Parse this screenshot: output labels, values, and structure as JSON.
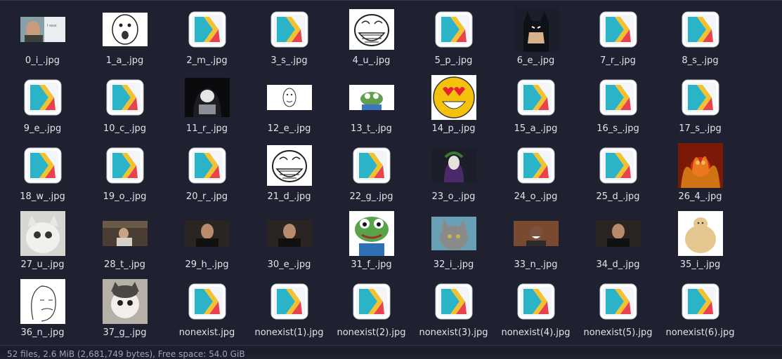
{
  "files": [
    {
      "name": "0_i_.jpg",
      "thumb": "photo-man-phone-thumb",
      "caption": "I ssss"
    },
    {
      "name": "1_a_.jpg",
      "thumb": "meme-face-lol-thumb"
    },
    {
      "name": "2_m_.jpg",
      "thumb": "broken-image-app-icon"
    },
    {
      "name": "3_s_.jpg",
      "thumb": "broken-image-app-icon"
    },
    {
      "name": "4_u_.jpg",
      "thumb": "troll-face-thumb"
    },
    {
      "name": "5_p_.jpg",
      "thumb": "broken-image-app-icon"
    },
    {
      "name": "6_e_.jpg",
      "thumb": "batman-thumb"
    },
    {
      "name": "7_r_.jpg",
      "thumb": "broken-image-app-icon"
    },
    {
      "name": "8_s_.jpg",
      "thumb": "broken-image-app-icon"
    },
    {
      "name": "9_e_.jpg",
      "thumb": "broken-image-app-icon"
    },
    {
      "name": "10_c_.jpg",
      "thumb": "broken-image-app-icon"
    },
    {
      "name": "11_r_.jpg",
      "thumb": "hacker-troll-thumb"
    },
    {
      "name": "12_e_.jpg",
      "thumb": "meme-face-small-thumb"
    },
    {
      "name": "13_t_.jpg",
      "thumb": "pepe-small-thumb"
    },
    {
      "name": "14_p_.jpg",
      "thumb": "heart-eyes-face-thumb"
    },
    {
      "name": "15_a_.jpg",
      "thumb": "broken-image-app-icon"
    },
    {
      "name": "16_s_.jpg",
      "thumb": "broken-image-app-icon"
    },
    {
      "name": "17_s_.jpg",
      "thumb": "broken-image-app-icon"
    },
    {
      "name": "18_w_.jpg",
      "thumb": "broken-image-app-icon"
    },
    {
      "name": "19_o_.jpg",
      "thumb": "broken-image-app-icon"
    },
    {
      "name": "20_r_.jpg",
      "thumb": "broken-image-app-icon"
    },
    {
      "name": "21_d_.jpg",
      "thumb": "troll-face-thumb"
    },
    {
      "name": "22_g_.jpg",
      "thumb": "broken-image-app-icon"
    },
    {
      "name": "23_o_.jpg",
      "thumb": "joker-thumb"
    },
    {
      "name": "24_o_.jpg",
      "thumb": "broken-image-app-icon"
    },
    {
      "name": "25_d_.jpg",
      "thumb": "broken-image-app-icon"
    },
    {
      "name": "26_4_.jpg",
      "thumb": "elmo-fire-thumb"
    },
    {
      "name": "27_u_.jpg",
      "thumb": "crying-cat-thumb"
    },
    {
      "name": "28_t_.jpg",
      "thumb": "photo-scene-thumb"
    },
    {
      "name": "29_h_.jpg",
      "thumb": "photo-man-thumb"
    },
    {
      "name": "30_e_.jpg",
      "thumb": "photo-man-thumb"
    },
    {
      "name": "31_f_.jpg",
      "thumb": "pepe-thinking-thumb"
    },
    {
      "name": "32_i_.jpg",
      "thumb": "cat-photo-thumb"
    },
    {
      "name": "33_n_.jpg",
      "thumb": "photo-man-laughing-thumb"
    },
    {
      "name": "34_d_.jpg",
      "thumb": "photo-man-thumb"
    },
    {
      "name": "35_i_.jpg",
      "thumb": "buff-doge-thumb"
    },
    {
      "name": "36_n_.jpg",
      "thumb": "wojak-sketch-thumb"
    },
    {
      "name": "37_g_.jpg",
      "thumb": "sad-cat-thumb"
    },
    {
      "name": "nonexist.jpg",
      "thumb": "broken-image-app-icon"
    },
    {
      "name": "nonexist(1).jpg",
      "thumb": "broken-image-app-icon"
    },
    {
      "name": "nonexist(2).jpg",
      "thumb": "broken-image-app-icon"
    },
    {
      "name": "nonexist(3).jpg",
      "thumb": "broken-image-app-icon"
    },
    {
      "name": "nonexist(4).jpg",
      "thumb": "broken-image-app-icon"
    },
    {
      "name": "nonexist(5).jpg",
      "thumb": "broken-image-app-icon"
    },
    {
      "name": "nonexist(6).jpg",
      "thumb": "broken-image-app-icon"
    }
  ],
  "statusbar": {
    "text": "52 files, 2.6 MiB (2,681,749 bytes), Free space: 54.0 GiB"
  },
  "colors": {
    "background": "#1f2130",
    "text": "#e2e4ea",
    "app_icon_teal": "#2bb3c8",
    "app_icon_yellow": "#f2c230",
    "app_icon_red": "#e8434c"
  }
}
